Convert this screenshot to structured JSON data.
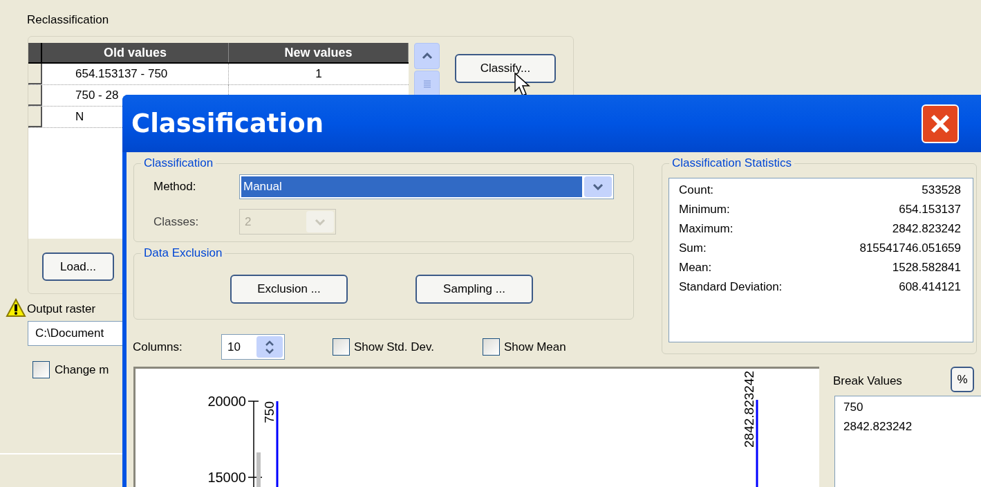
{
  "background_window": {
    "section_title": "Reclassification",
    "table": {
      "columns": [
        "Old values",
        "New values"
      ],
      "rows": [
        {
          "cells": [
            "654.153137 - 750",
            "1"
          ]
        },
        {
          "cells": [
            "750 - 28"
          ]
        },
        {
          "cells": [
            "N"
          ]
        }
      ]
    },
    "buttons": [
      "Classify...",
      "Load..."
    ],
    "output_raster": {
      "label": "Output raster",
      "value": "C:\\Document"
    },
    "checkbox": {
      "label": "Change m",
      "checked": false
    }
  },
  "dialog": {
    "title": "Classification",
    "classification_group": {
      "title": "Classification",
      "method": {
        "label": "Method:",
        "value": "Manual"
      },
      "classes": {
        "label": "Classes:",
        "value": "2",
        "disabled": true
      }
    },
    "data_exclusion_group": {
      "title": "Data Exclusion",
      "buttons": [
        "Exclusion ...",
        "Sampling ..."
      ]
    },
    "statistics": {
      "title": "Classification Statistics",
      "rows": [
        {
          "label": "Count:",
          "value": "533528"
        },
        {
          "label": "Minimum:",
          "value": "654.153137"
        },
        {
          "label": "Maximum:",
          "value": "2842.823242"
        },
        {
          "label": "Sum:",
          "value": "815541746.051659"
        },
        {
          "label": "Mean:",
          "value": "1528.582841"
        },
        {
          "label": "Standard Deviation:",
          "value": "608.414121"
        }
      ]
    },
    "columns": {
      "label": "Columns:",
      "value": "10"
    },
    "options": [
      {
        "label": "Show Std. Dev.",
        "checked": false
      },
      {
        "label": "Show Mean",
        "checked": false
      }
    ],
    "histogram": {
      "y_labels": [
        "20000",
        "15000"
      ],
      "break_labels": [
        "750",
        "2842.823242"
      ]
    },
    "break_values": {
      "label": "Break Values",
      "percent_button": "%",
      "values": [
        "750",
        "2842.823242"
      ]
    }
  }
}
